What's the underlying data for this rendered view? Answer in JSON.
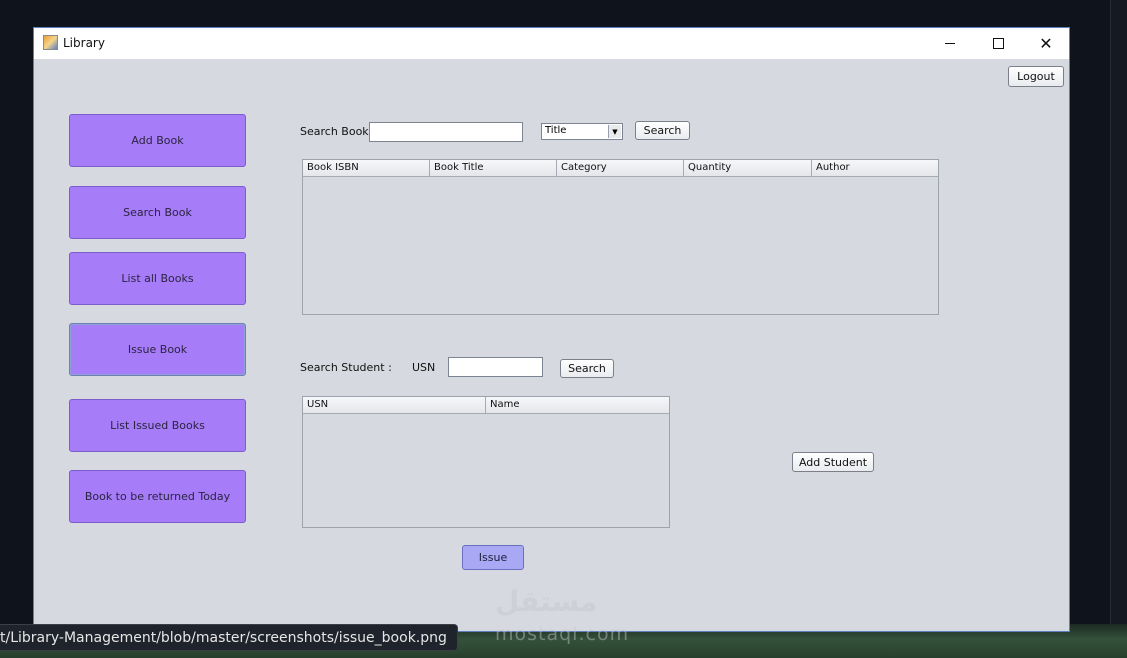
{
  "window": {
    "title": "Library",
    "close_glyph": "✕",
    "arrow_glyph": "▼"
  },
  "header": {
    "logout_label": "Logout"
  },
  "sidebar": {
    "items": [
      {
        "label": "Add Book"
      },
      {
        "label": "Search Book"
      },
      {
        "label": "List all Books"
      },
      {
        "label": "Issue Book",
        "active": true
      },
      {
        "label": "List Issued Books"
      },
      {
        "label": "Book to be returned Today"
      }
    ]
  },
  "book_search": {
    "label": "Search Book",
    "input_value": "",
    "filter_selected": "Title",
    "search_label": "Search",
    "columns": [
      "Book ISBN",
      "Book Title",
      "Category",
      "Quantity",
      "Author"
    ],
    "rows": []
  },
  "student_search": {
    "label": "Search Student :",
    "usn_label": "USN",
    "input_value": "",
    "search_label": "Search",
    "columns": [
      "USN",
      "Name"
    ],
    "rows": []
  },
  "actions": {
    "add_student_label": "Add Student",
    "issue_label": "Issue"
  },
  "status_tooltip": "t/Library-Management/blob/master/screenshots/issue_book.png",
  "watermark": {
    "arabic": "مستقل",
    "latin": "mostaql.com"
  },
  "colors": {
    "sidebar_button": "#a67cf8",
    "issue_button": "#a9a8f4",
    "window_bg": "#d6d9e0",
    "desktop_bg": "#0f141c"
  }
}
